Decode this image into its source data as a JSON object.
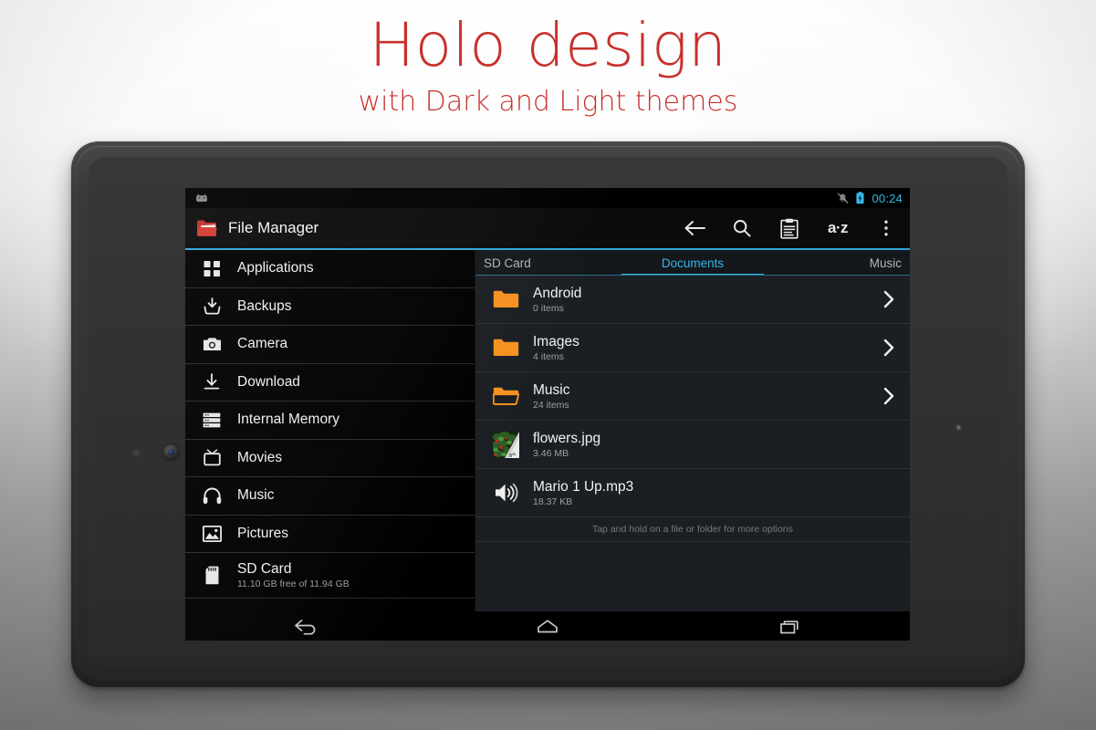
{
  "headline": {
    "title": "Holo design",
    "subtitle": "with Dark and Light themes",
    "color": "#c8302c"
  },
  "device": {
    "name": "android-tablet",
    "camera_icon": "camera-lens-icon",
    "sensor_icon": "proximity-sensor-icon"
  },
  "statusbar": {
    "notification_icon": "android-head-icon",
    "ringer_icon": "ringer-muted-icon",
    "battery_icon": "battery-charging-icon",
    "clock": "00:24",
    "accent_color": "#35b7e8"
  },
  "actionbar": {
    "app_icon": "folder-app-icon",
    "title": "File Manager",
    "actions": [
      {
        "name": "back-button",
        "icon": "arrow-left-icon",
        "label": "Back"
      },
      {
        "name": "search-button",
        "icon": "search-icon",
        "label": "Search"
      },
      {
        "name": "clipboard-button",
        "icon": "clipboard-icon",
        "label": "Clipboard"
      },
      {
        "name": "sort-button",
        "icon": "sort-alpha-icon",
        "label": "a·z"
      },
      {
        "name": "overflow-button",
        "icon": "overflow-menu-icon",
        "label": "More options"
      }
    ],
    "accent_color": "#2fa8d8"
  },
  "sidebar": {
    "items": [
      {
        "label": "Applications",
        "icon": "apps-grid-icon",
        "sub": null
      },
      {
        "label": "Backups",
        "icon": "backup-download-icon",
        "sub": null
      },
      {
        "label": "Camera",
        "icon": "camera-icon",
        "sub": null
      },
      {
        "label": "Download",
        "icon": "download-icon",
        "sub": null
      },
      {
        "label": "Internal Memory",
        "icon": "storage-icon",
        "sub": null
      },
      {
        "label": "Movies",
        "icon": "tv-icon",
        "sub": null
      },
      {
        "label": "Music",
        "icon": "headphones-icon",
        "sub": null
      },
      {
        "label": "Pictures",
        "icon": "picture-icon",
        "sub": null
      },
      {
        "label": "SD Card",
        "icon": "sd-card-icon",
        "sub": "11.10 GB free of 11.94 GB"
      }
    ]
  },
  "tabs": [
    {
      "label": "SD Card",
      "active": false
    },
    {
      "label": "Documents",
      "active": true
    },
    {
      "label": "Music",
      "active": false
    }
  ],
  "filelist": {
    "rows": [
      {
        "name": "Android",
        "sub": "0 items",
        "icon": "folder-icon",
        "chevron": true
      },
      {
        "name": "Images",
        "sub": "4 items",
        "icon": "folder-icon",
        "chevron": true
      },
      {
        "name": "Music",
        "sub": "24 items",
        "icon": "folder-open-icon",
        "chevron": true
      },
      {
        "name": "flowers.jpg",
        "sub": "3.46 MB",
        "icon": "image-thumbnail",
        "chevron": false
      },
      {
        "name": "Mario 1 Up.mp3",
        "sub": "18.37 KB",
        "icon": "audio-speaker-icon",
        "chevron": false
      }
    ],
    "hint": "Tap and hold on a file or folder for more options",
    "folder_color": "#f59120"
  },
  "navbar": {
    "buttons": [
      {
        "name": "nav-back-button",
        "icon": "nav-back-icon"
      },
      {
        "name": "nav-home-button",
        "icon": "nav-home-icon"
      },
      {
        "name": "nav-recents-button",
        "icon": "nav-recents-icon"
      }
    ]
  }
}
